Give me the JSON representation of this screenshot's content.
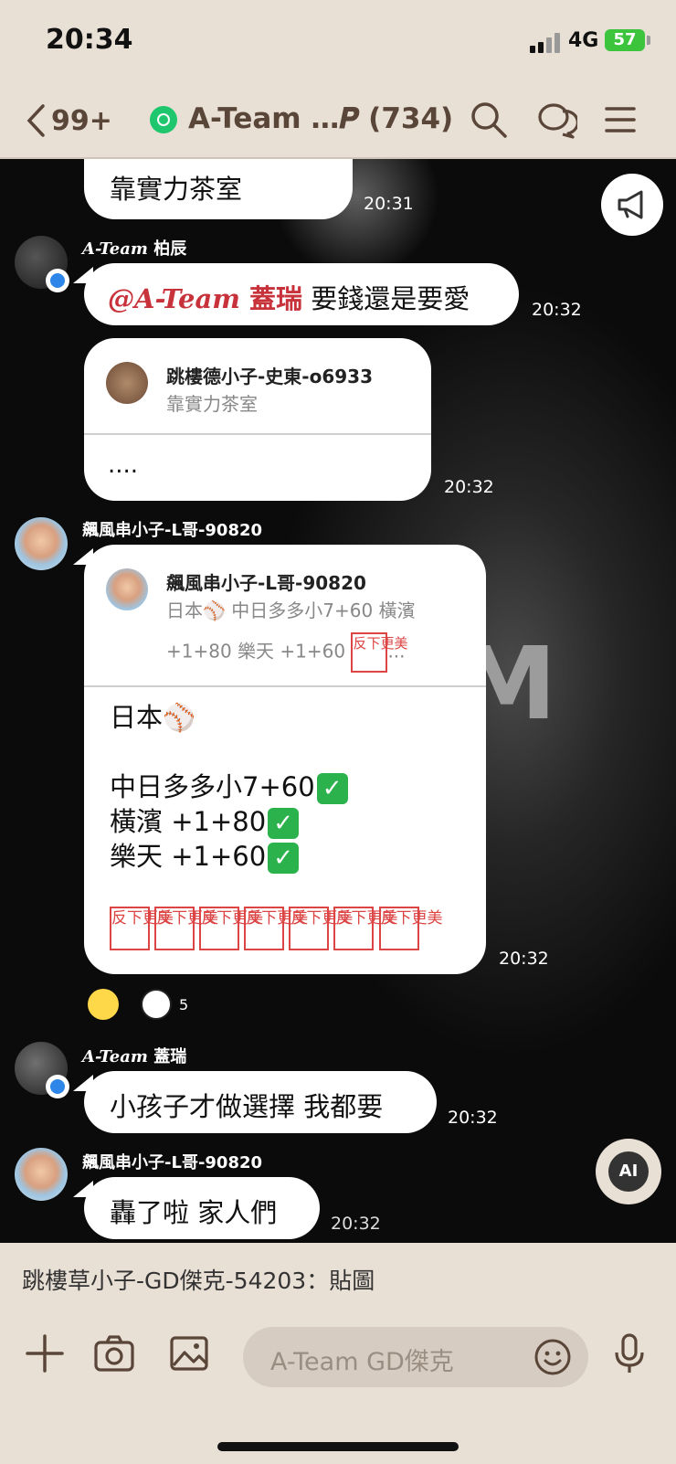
{
  "status": {
    "time": "20:34",
    "network": "4G",
    "battery": "57"
  },
  "header": {
    "back_count": "99+",
    "group_title": "A-Team …𝑷 (734)"
  },
  "messages": {
    "m1": {
      "text": "靠實力茶室",
      "time": "20:31"
    },
    "m2": {
      "sender_italic": "A-Team",
      "sender_name": " 柏辰",
      "mention_italic": "@A-Team",
      "mention_name": " 蓋瑞",
      "text": " 要錢還是要愛",
      "time": "20:32"
    },
    "m3": {
      "reply_name": "跳樓德小子-史東-o6933",
      "reply_text": "靠實力茶室",
      "text": "....",
      "time": "20:32"
    },
    "m4": {
      "sender": "飆風串小子-L哥-90820",
      "reply_name": "飆風串小子-L哥-90820",
      "reply_line1": "日本⚾️ 中日多多小7+60 橫濱",
      "reply_line2a": "+1+80 樂天 +1+60 ",
      "reply_line2b": "...",
      "line1": "日本⚾️",
      "line2": "中日多多小7+60",
      "line3": "橫濱 +1+80",
      "line4": "樂天 +1+60",
      "stamp_text": "反下更美",
      "time": "20:32",
      "reaction_count": "5"
    },
    "m5": {
      "sender_italic": "A-Team",
      "sender_name": " 蓋瑞",
      "text": "小孩子才做選擇 我都要",
      "time": "20:32"
    },
    "m6": {
      "sender": "飆風串小子-L哥-90820",
      "text": "轟了啦 家人們",
      "time": "20:32"
    }
  },
  "ai_button": "AI",
  "notice": {
    "text": "跳樓草小子-GD傑克-54203：貼圖"
  },
  "input": {
    "placeholder": "A-Team GD傑克"
  },
  "icons": [
    "back-chevron-icon",
    "search-icon",
    "chat-bubbles-icon",
    "menu-icon",
    "megaphone-icon",
    "plus-icon",
    "camera-icon",
    "image-icon",
    "emoji-icon",
    "mic-icon"
  ]
}
